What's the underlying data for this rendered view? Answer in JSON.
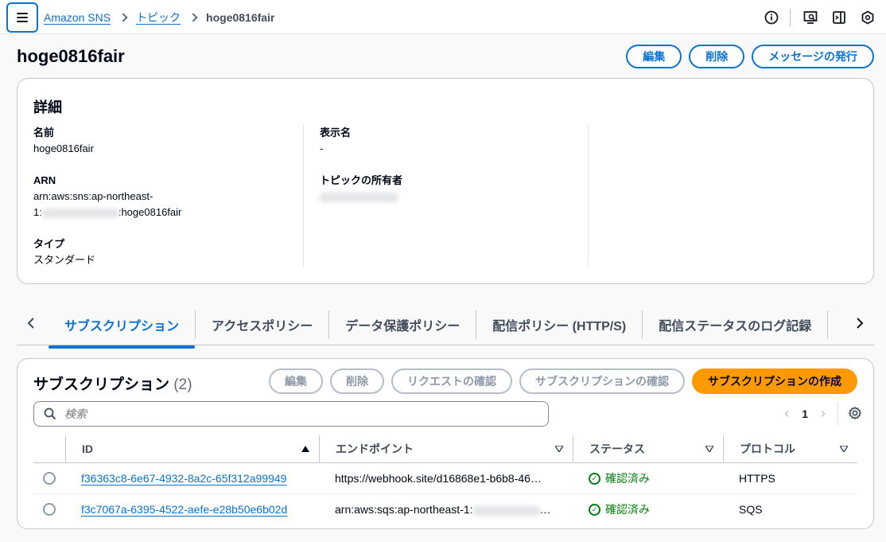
{
  "breadcrumb": {
    "root": "Amazon SNS",
    "section": "トピック",
    "current": "hoge0816fair"
  },
  "header": {
    "title": "hoge0816fair",
    "edit_label": "編集",
    "delete_label": "削除",
    "publish_label": "メッセージの発行"
  },
  "details": {
    "title": "詳細",
    "name_label": "名前",
    "name_value": "hoge0816fair",
    "arn_label": "ARN",
    "arn_line1": "arn:aws:sns:ap-northeast-",
    "arn_line2_prefix": "1:",
    "arn_line2_suffix": ":hoge0816fair",
    "type_label": "タイプ",
    "type_value": "スタンダード",
    "display_name_label": "表示名",
    "display_name_value": "-",
    "owner_label": "トピックの所有者"
  },
  "tabs": [
    {
      "label": "サブスクリプション"
    },
    {
      "label": "アクセスポリシー"
    },
    {
      "label": "データ保護ポリシー"
    },
    {
      "label": "配信ポリシー (HTTP/S)"
    },
    {
      "label": "配信ステータスのログ記録"
    }
  ],
  "subscriptions": {
    "title": "サブスクリプション",
    "count": "(2)",
    "actions": {
      "edit": "編集",
      "delete": "削除",
      "confirm_request": "リクエストの確認",
      "confirm_subscription": "サブスクリプションの確認",
      "create": "サブスクリプションの作成"
    },
    "search_placeholder": "検索",
    "page": "1",
    "columns": {
      "id": "ID",
      "endpoint": "エンドポイント",
      "status": "ステータス",
      "protocol": "プロトコル"
    },
    "rows": [
      {
        "id": "f36363c8-6e67-4932-8a2c-65f312a99949",
        "endpoint": "https://webhook.site/d16868e1-b6b8-46…",
        "status": "確認済み",
        "protocol": "HTTPS"
      },
      {
        "id": "f3c7067a-6395-4522-aefe-e28b50e6b02d",
        "endpoint_prefix": "arn:aws:sqs:ap-northeast-1:",
        "endpoint_suffix": "…",
        "status": "確認済み",
        "protocol": "SQS"
      }
    ]
  }
}
